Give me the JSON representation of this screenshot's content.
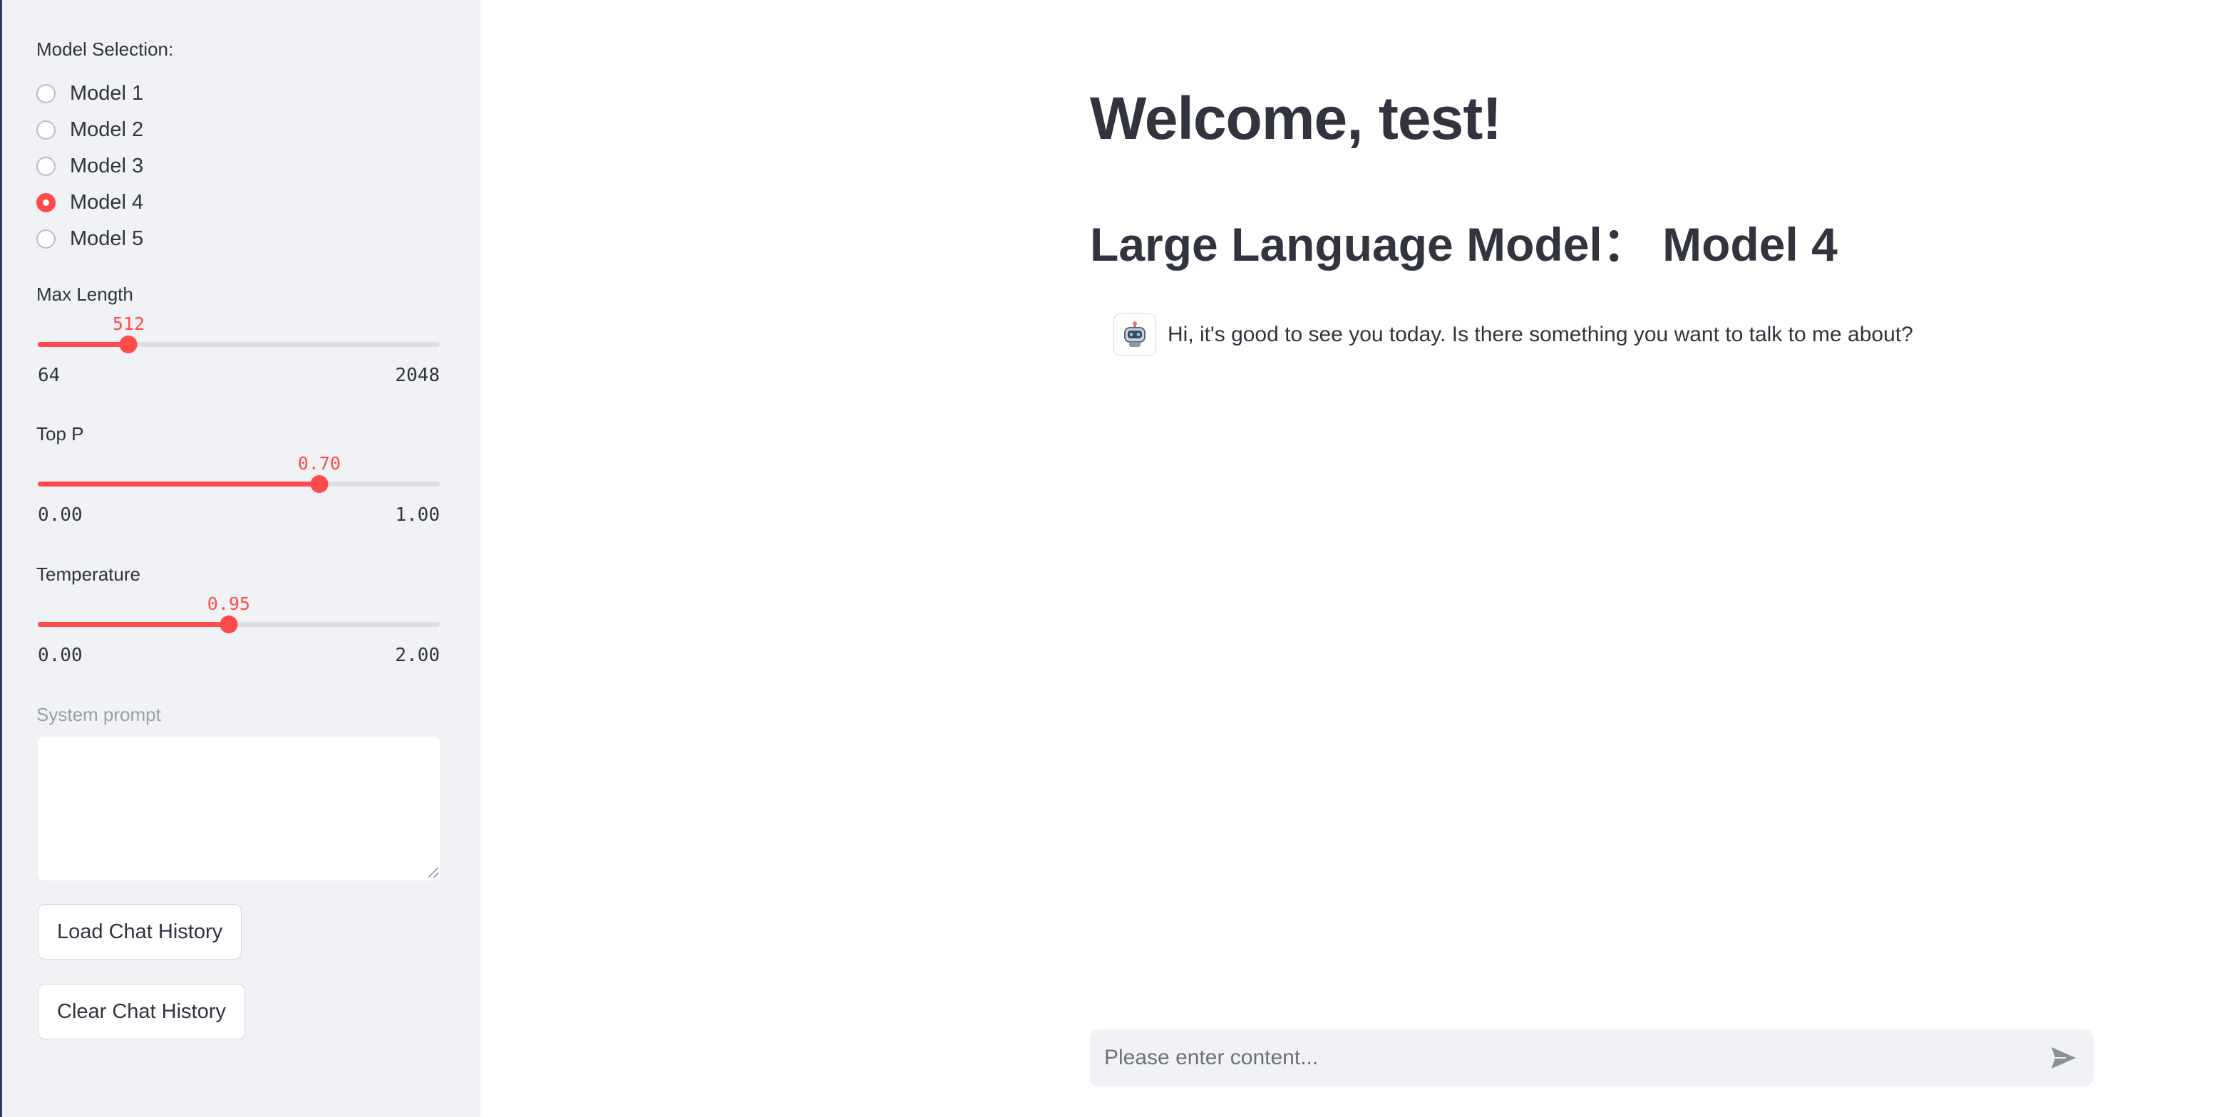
{
  "sidebar": {
    "model_selection": {
      "label": "Model Selection:",
      "options": [
        "Model 1",
        "Model 2",
        "Model 3",
        "Model 4",
        "Model 5"
      ],
      "selected": "Model 4"
    },
    "max_length": {
      "label": "Max Length",
      "value": "512",
      "min": "64",
      "max": "2048",
      "fraction": 0.226
    },
    "top_p": {
      "label": "Top P",
      "value": "0.70",
      "min": "0.00",
      "max": "1.00",
      "fraction": 0.7
    },
    "temperature": {
      "label": "Temperature",
      "value": "0.95",
      "min": "0.00",
      "max": "2.00",
      "fraction": 0.475
    },
    "system_prompt": {
      "label": "System prompt",
      "value": ""
    },
    "load_button": "Load Chat History",
    "clear_button": "Clear Chat History"
  },
  "main": {
    "welcome_title": "Welcome, test!",
    "model_heading": "Large Language Model：  Model 4",
    "messages": [
      {
        "role": "assistant",
        "avatar": "robot-icon",
        "text": "Hi, it's good to see you today. Is there something you want to talk to me about?"
      }
    ],
    "chat_input": {
      "placeholder": "Please enter content...",
      "value": ""
    },
    "send_icon": "send-icon"
  },
  "colors": {
    "accent": "#ff4b4b",
    "sidebar_bg": "#f0f2f6",
    "text": "#31333f",
    "track": "#dcdee4"
  }
}
